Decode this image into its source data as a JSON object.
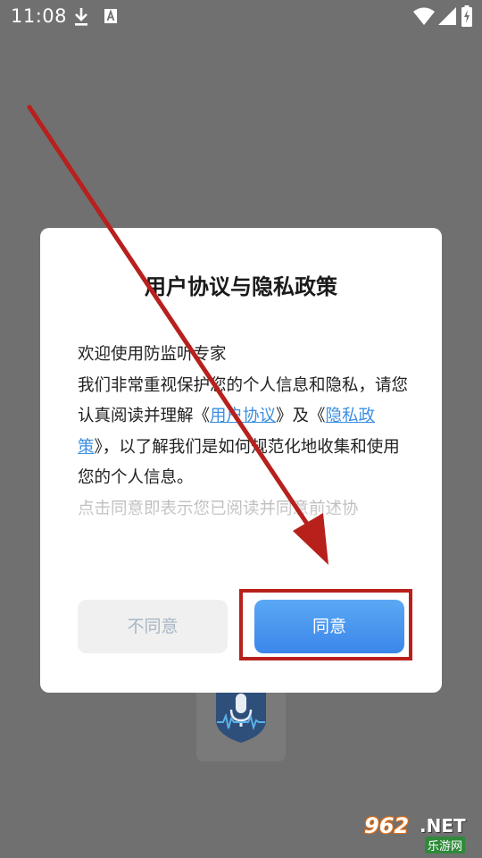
{
  "status_bar": {
    "time": "11:08"
  },
  "dialog": {
    "title": "用户协议与隐私政策",
    "line1": "欢迎使用防监听专家",
    "p2_before": "我们非常重视保护您的个人信息和隐私，请您认真阅读并理解《",
    "p2_link1": "用户协议",
    "p2_mid": "》及《",
    "p2_link2": "隐私政策",
    "p2_after": "》，以了解我们是如何规范化地收集和使用您的个人信息。",
    "p3_faded": "点击同意即表示您已阅读并同意前述协",
    "disagree_label": "不同意",
    "agree_label": "同意"
  },
  "watermark": {
    "number": "962",
    "suffix": ".NET",
    "site_name": "乐游网"
  },
  "colors": {
    "overlay_bg": "#707070",
    "link": "#3d8fe0",
    "agree_button": "#3b86ea",
    "annotation_red": "#b8201c"
  },
  "icons": [
    "download-icon",
    "keyboard-a-icon",
    "wifi-icon",
    "signal-icon",
    "battery-charging-icon",
    "microphone-shield-icon"
  ]
}
